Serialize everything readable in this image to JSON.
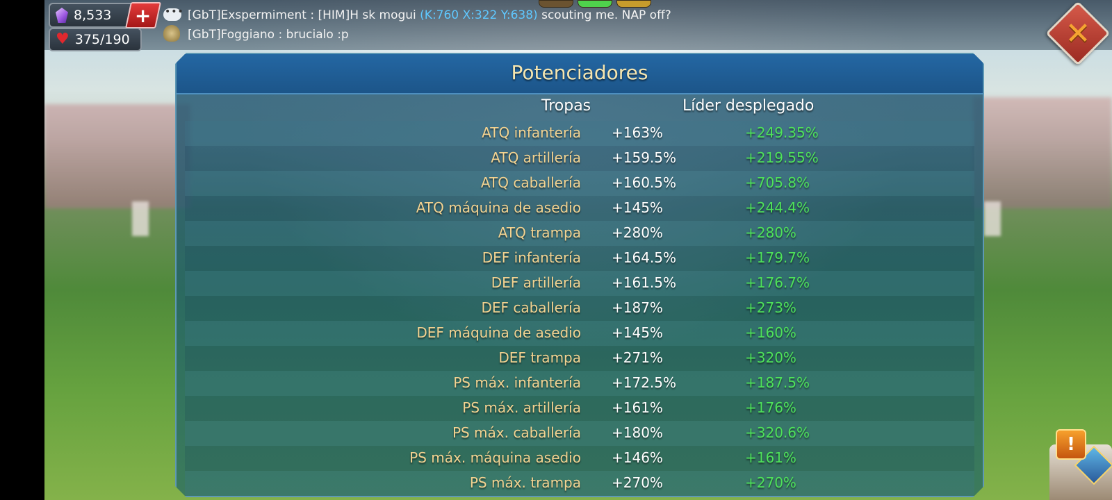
{
  "resources": {
    "gems": "8,533",
    "stamina": "375/190",
    "add_label": "+"
  },
  "chat": {
    "line1_prefix": "[GbT]Exspermiment : [HIM]H sk mogui ",
    "line1_coords": "(K:760 X:322 Y:638)",
    "line1_suffix": " scouting me. NAP off?",
    "line2": "[GbT]Foggiano : brucialo :p"
  },
  "close_label": "✕",
  "quest_label": "!",
  "panel": {
    "title": "Potenciadores",
    "col_troops": "Tropas",
    "col_leader": "Líder desplegado",
    "rows": [
      {
        "label": "ATQ infantería",
        "troops": "+163%",
        "leader": "+249.35%"
      },
      {
        "label": "ATQ artillería",
        "troops": "+159.5%",
        "leader": "+219.55%"
      },
      {
        "label": "ATQ caballería",
        "troops": "+160.5%",
        "leader": "+705.8%"
      },
      {
        "label": "ATQ máquina de asedio",
        "troops": "+145%",
        "leader": "+244.4%"
      },
      {
        "label": "ATQ trampa",
        "troops": "+280%",
        "leader": "+280%"
      },
      {
        "label": "DEF infantería",
        "troops": "+164.5%",
        "leader": "+179.7%"
      },
      {
        "label": "DEF artillería",
        "troops": "+161.5%",
        "leader": "+176.7%"
      },
      {
        "label": "DEF caballería",
        "troops": "+187%",
        "leader": "+273%"
      },
      {
        "label": "DEF máquina de asedio",
        "troops": "+145%",
        "leader": "+160%"
      },
      {
        "label": "DEF trampa",
        "troops": "+271%",
        "leader": "+320%"
      },
      {
        "label": "PS máx. infantería",
        "troops": "+172.5%",
        "leader": "+187.5%"
      },
      {
        "label": "PS máx. artillería",
        "troops": "+161%",
        "leader": "+176%"
      },
      {
        "label": "PS máx. caballería",
        "troops": "+180%",
        "leader": "+320.6%"
      },
      {
        "label": "PS máx. máquina asedio",
        "troops": "+146%",
        "leader": "+161%"
      },
      {
        "label": "PS máx. trampa",
        "troops": "+270%",
        "leader": "+270%"
      }
    ]
  },
  "colors": {
    "label": "#f3d391",
    "troops_value": "#ffffff",
    "leader_value": "#4ee35a",
    "chat_coords": "#5fc8ff",
    "title": "#f6e6b0"
  }
}
